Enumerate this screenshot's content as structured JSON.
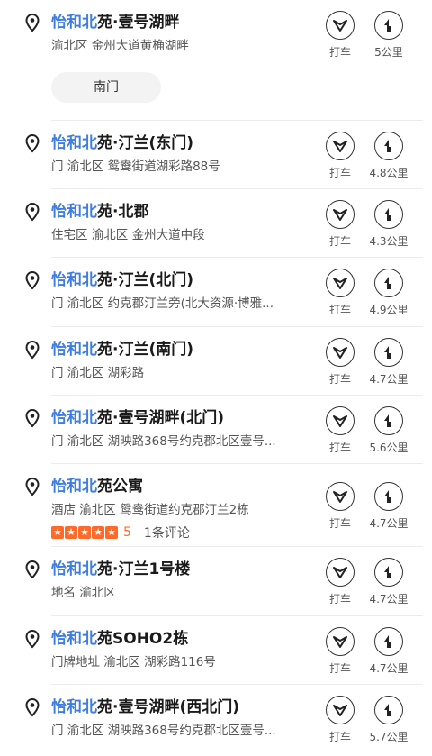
{
  "results": [
    {
      "title_hl": "怡和北",
      "title_rest": "苑·壹号湖畔",
      "addr": "渝北区 金州大道黄桷湖畔",
      "sub_button": "南门",
      "taxi": "打车",
      "distance": "5公里"
    },
    {
      "title_hl": "怡和北",
      "title_rest": "苑·汀兰(东门)",
      "addr": "门 渝北区 鸳鸯街道湖彩路88号",
      "taxi": "打车",
      "distance": "4.8公里"
    },
    {
      "title_hl": "怡和北",
      "title_rest": "苑·北郡",
      "addr": "住宅区 渝北区 金州大道中段",
      "taxi": "打车",
      "distance": "4.3公里"
    },
    {
      "title_hl": "怡和北",
      "title_rest": "苑·汀兰(北门)",
      "addr": "门 渝北区 约克郡汀兰旁(北大资源·博雅...",
      "taxi": "打车",
      "distance": "4.9公里"
    },
    {
      "title_hl": "怡和北",
      "title_rest": "苑·汀兰(南门)",
      "addr": "门 渝北区 湖彩路",
      "taxi": "打车",
      "distance": "4.7公里"
    },
    {
      "title_hl": "怡和北",
      "title_rest": "苑·壹号湖畔(北门)",
      "addr": "门 渝北区 湖映路368号约克郡北区壹号...",
      "taxi": "打车",
      "distance": "5.6公里"
    },
    {
      "title_hl": "怡和北",
      "title_rest": "苑公寓",
      "addr": "酒店 渝北区 鸳鸯街道约克郡汀兰2栋",
      "rating": {
        "score": "5",
        "stars": 5,
        "reviews": "1条评论"
      },
      "taxi": "打车",
      "distance": "4.7公里"
    },
    {
      "title_hl": "怡和北",
      "title_rest": "苑·汀兰1号楼",
      "addr": "地名 渝北区",
      "taxi": "打车",
      "distance": "4.7公里"
    },
    {
      "title_hl": "怡和北",
      "title_rest": "苑SOHO2栋",
      "addr": "门牌地址 渝北区 湖彩路116号",
      "taxi": "打车",
      "distance": "4.7公里"
    },
    {
      "title_hl": "怡和北",
      "title_rest": "苑·壹号湖畔(西北门)",
      "addr": "门 渝北区 湖映路368号约克郡北区壹号...",
      "taxi": "打车",
      "distance": "5.7公里"
    }
  ],
  "icons": {
    "pin": "location-pin-icon",
    "taxi": "taxi-icon",
    "distance": "navigation-arrow-icon"
  },
  "colors": {
    "highlight": "#3f7de0",
    "rating": "#ff6a2a"
  }
}
